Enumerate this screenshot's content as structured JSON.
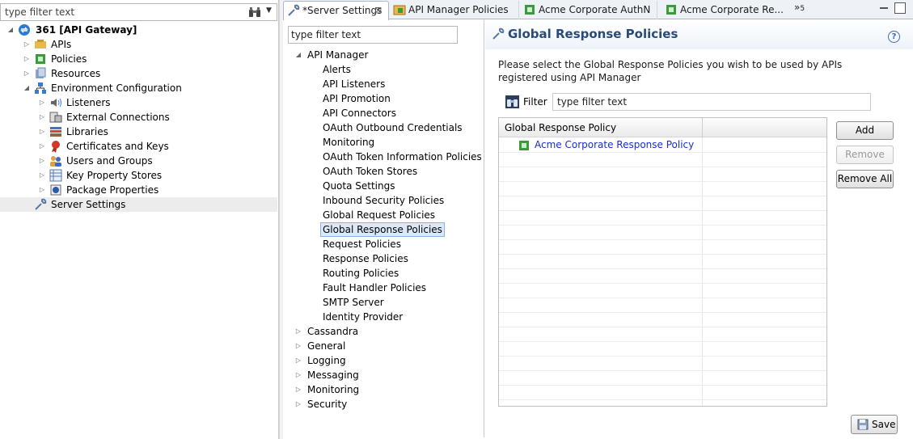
{
  "left": {
    "filter_placeholder": "type filter text",
    "tree": [
      {
        "label": "361 [API Gateway]",
        "icon": "gateway-icon",
        "bold": true
      },
      {
        "label": "APIs",
        "icon": "apis-icon"
      },
      {
        "label": "Policies",
        "icon": "policies-icon"
      },
      {
        "label": "Resources",
        "icon": "resources-icon"
      },
      {
        "label": "Environment Configuration",
        "icon": "environment-icon"
      },
      {
        "label": "Listeners",
        "icon": "listeners-icon"
      },
      {
        "label": "External Connections",
        "icon": "external-connections-icon"
      },
      {
        "label": "Libraries",
        "icon": "libraries-icon"
      },
      {
        "label": "Certificates and Keys",
        "icon": "certificates-icon"
      },
      {
        "label": "Users and Groups",
        "icon": "users-icon"
      },
      {
        "label": "Key Property Stores",
        "icon": "key-property-stores-icon"
      },
      {
        "label": "Package Properties",
        "icon": "package-properties-icon"
      },
      {
        "label": "Server Settings",
        "icon": "server-settings-icon",
        "selected": true
      }
    ]
  },
  "tabs": [
    {
      "label": "*Server Settings",
      "active": true,
      "icon": "wrench-icon"
    },
    {
      "label": "API Manager Policies",
      "icon": "api-manager-policies-icon"
    },
    {
      "label": "Acme Corporate AuthN",
      "icon": "policy-icon"
    },
    {
      "label": "Acme Corporate Re...",
      "icon": "policy-icon"
    }
  ],
  "overflow_chevron": "»",
  "overflow_count": "5",
  "settings": {
    "filter_placeholder": "type filter text",
    "tree": [
      {
        "label": "API Manager",
        "expanded": true
      },
      {
        "label": "Alerts"
      },
      {
        "label": "API Listeners"
      },
      {
        "label": "API Promotion"
      },
      {
        "label": "API Connectors"
      },
      {
        "label": "OAuth Outbound Credentials"
      },
      {
        "label": "Monitoring"
      },
      {
        "label": "OAuth Token Information Policies"
      },
      {
        "label": "OAuth Token Stores"
      },
      {
        "label": "Quota Settings"
      },
      {
        "label": "Inbound Security Policies"
      },
      {
        "label": "Global Request Policies"
      },
      {
        "label": "Global Response Policies",
        "selected": true
      },
      {
        "label": "Request Policies"
      },
      {
        "label": "Response Policies"
      },
      {
        "label": "Routing Policies"
      },
      {
        "label": "Fault Handler Policies"
      },
      {
        "label": "SMTP Server"
      },
      {
        "label": "Identity Provider"
      },
      {
        "label": "Cassandra",
        "collapsed": true
      },
      {
        "label": "General",
        "collapsed": true
      },
      {
        "label": "Logging",
        "collapsed": true
      },
      {
        "label": "Messaging",
        "collapsed": true
      },
      {
        "label": "Monitoring",
        "collapsed": true
      },
      {
        "label": "Security",
        "collapsed": true
      }
    ]
  },
  "content": {
    "title": "Global Response Policies",
    "help": "?",
    "description": "Please select the Global Response Policies you wish to be used by APIs registered using API Manager",
    "filter_label": "Filter",
    "filter_placeholder": "type filter text",
    "table": {
      "header": "Global Response Policy",
      "rows": [
        "Acme Corporate Response Policy"
      ]
    },
    "buttons": {
      "add": "Add",
      "remove": "Remove",
      "remove_all": "Remove All",
      "save": "Save"
    }
  },
  "colors": {
    "title": "#2a4a78",
    "link": "#1a2ecc",
    "selection": "#dbe8f7"
  }
}
